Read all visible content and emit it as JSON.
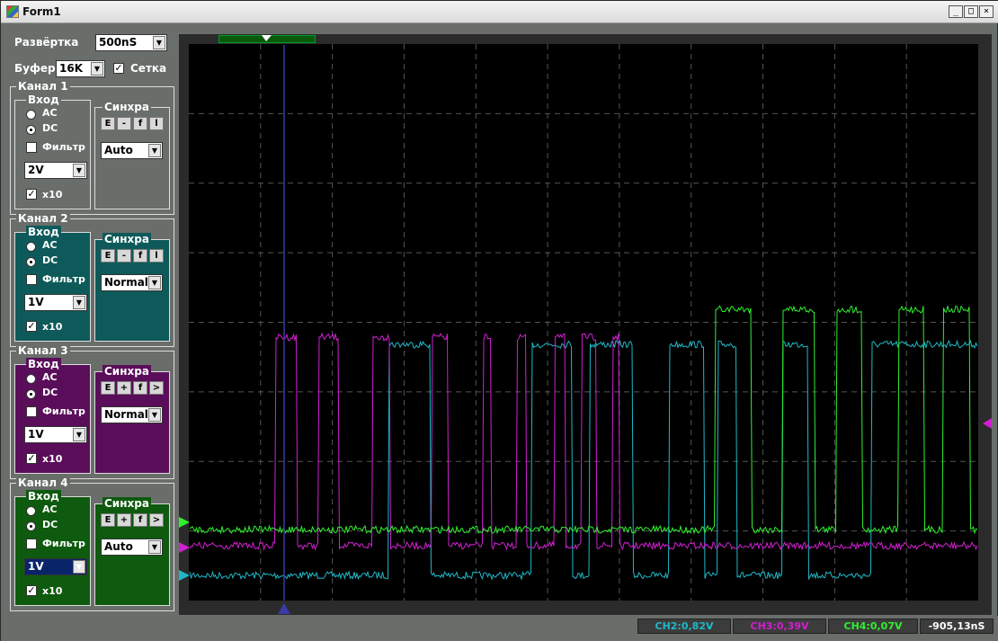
{
  "window": {
    "title": "Form1"
  },
  "controls": {
    "sweep_label": "Развёртка",
    "sweep_value": "500nS",
    "buffer_label": "Буфер",
    "buffer_value": "16K",
    "grid_label": "Сетка",
    "grid_checked": true
  },
  "channels": [
    {
      "title": "Канал 1",
      "input_label": "Вход",
      "ac": "AC",
      "dc": "DC",
      "filter": "Фильтр",
      "volts": "2V",
      "x10": "x10",
      "sync_label": "Синхра",
      "sync_buttons": [
        "E",
        "-",
        "f",
        "l"
      ],
      "mode": "Auto",
      "color": "#6a6e6a"
    },
    {
      "title": "Канал 2",
      "input_label": "Вход",
      "ac": "AC",
      "dc": "DC",
      "filter": "Фильтр",
      "volts": "1V",
      "x10": "x10",
      "sync_label": "Синхра",
      "sync_buttons": [
        "E",
        "-",
        "f",
        "l"
      ],
      "mode": "Normal",
      "color": "#0e5a5a"
    },
    {
      "title": "Канал 3",
      "input_label": "Вход",
      "ac": "AC",
      "dc": "DC",
      "filter": "Фильтр",
      "volts": "1V",
      "x10": "x10",
      "sync_label": "Синхра",
      "sync_buttons": [
        "E",
        "+",
        "f",
        ">"
      ],
      "mode": "Normal",
      "color": "#5a0e5a"
    },
    {
      "title": "Канал 4",
      "input_label": "Вход",
      "ac": "AC",
      "dc": "DC",
      "filter": "Фильтр",
      "volts": "1V",
      "x10": "x10",
      "sync_label": "Синхра",
      "sync_buttons": [
        "E",
        "+",
        "f",
        ">"
      ],
      "mode": "Auto",
      "color": "#0e5a0e"
    }
  ],
  "status": {
    "ch2": "CH2:0,82V",
    "ch3": "CH3:0,39V",
    "ch4": "CH4:0,07V",
    "time": "-905,13nS"
  },
  "colors": {
    "ch2": "#1fb8c8",
    "ch3": "#d020d0",
    "ch4": "#30f030"
  }
}
